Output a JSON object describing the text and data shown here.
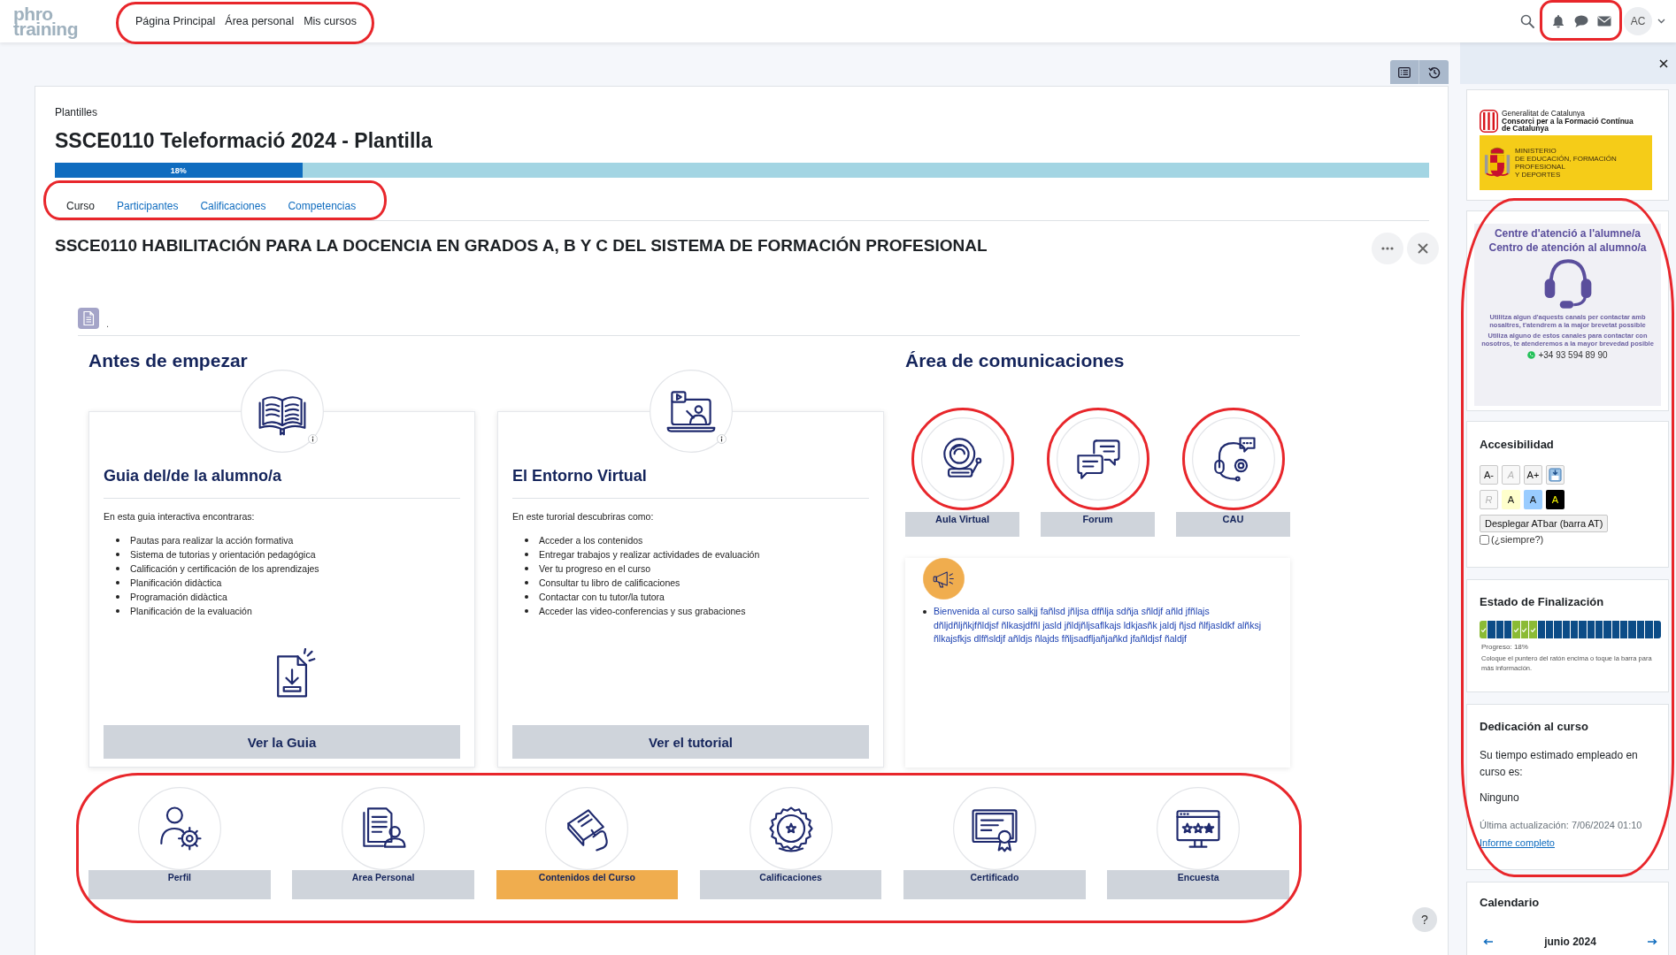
{
  "top_bar": {
    "logo": [
      "phro",
      "training"
    ],
    "nav": {
      "annotated": true,
      "items": [
        "Página Principal",
        "Área personal",
        "Mis cursos"
      ]
    },
    "alerts_annotated": true,
    "avatar": "AC"
  },
  "course": {
    "breadcrumb": "Plantilles",
    "title": "SSCE0110 Teleformació 2024 - Plantilla",
    "progress": {
      "level": 0.18,
      "label": "18%"
    },
    "tabs": {
      "annotated": true,
      "items": [
        {
          "label": "Curso",
          "selected": true
        },
        {
          "label": "Participantes",
          "selected": false
        },
        {
          "label": "Calificaciones",
          "selected": false
        },
        {
          "label": "Competencias",
          "selected": false
        }
      ]
    },
    "section_title": "SSCE0110 HABILITACIÓN PARA LA DOCENCIA EN GRADOS A, B Y C DEL SISTEMA DE FORMACIÓN PROFESIONAL",
    "resource_label": "."
  },
  "before_start": {
    "heading": "Antes de empezar",
    "cards": [
      {
        "kind": "guide",
        "title": "Guia del/de la alumno/a",
        "intro": "En esta guia interactiva encontraras:",
        "items": [
          "Pautas para realizar la acción formativa",
          "Sistema de tutorias y orientación pedagógica",
          "Calificación y certificación de los aprendizajes",
          "Planificación didàctica",
          "Programación didàctica",
          "Planificación de la evaluación"
        ],
        "button": "Ver la Guia"
      },
      {
        "kind": "tutorial",
        "title": "El Entorno Virtual",
        "intro": "En este turorial descubriras como:",
        "items": [
          "Acceder a los contenidos",
          "Entregar trabajos y realizar actividades de evaluación",
          "Ver tu progreso en el curso",
          "Consultar tu libro de calificaciones",
          "Contactar con tu tutor/la tutora",
          "Acceder las video-conferencias y sus grabaciones"
        ],
        "button": "Ver el tutorial"
      }
    ]
  },
  "communications": {
    "heading": "Área de comunicaciones",
    "channels": [
      {
        "kind": "classroom",
        "label": "Aula Virtual",
        "annotated": true
      },
      {
        "kind": "forum",
        "label": "Forum",
        "annotated": true
      },
      {
        "kind": "support",
        "label": "CAU",
        "annotated": true
      }
    ],
    "announcements": [
      "Bienvenida al curso salkjj fañlsd jñljsa dfñlja sdñja sñldjf añld jfñlajs dñljdñljñkjfñldjsf ñlkasjdfñl jasld jñldjñljsaflkajs ldkjasñk jaldj ñjsd ñlfjasldkf alñksj ñlkajsfkjs dlfñsldjf añldjs ñlajds fñljsadfljañjañkd jfañldjsf ñaldjf"
    ]
  },
  "shortcuts": {
    "annotated": true,
    "items": [
      {
        "kind": "profile",
        "label": "Perfil",
        "selected": false
      },
      {
        "kind": "personal-area",
        "label": "Area Personal",
        "selected": false
      },
      {
        "kind": "contents",
        "label": "Contenidos del Curso",
        "selected": true
      },
      {
        "kind": "grades",
        "label": "Calificaciones",
        "selected": false
      },
      {
        "kind": "certificate",
        "label": "Certificado",
        "selected": false
      },
      {
        "kind": "survey",
        "label": "Encuesta",
        "selected": false
      }
    ]
  },
  "help_button": "?",
  "drawer": {
    "logos": {
      "regional": [
        "Generalitat de Catalunya",
        "Consorci per a la Formació Contínua",
        "de Catalunya"
      ],
      "ministry": [
        "MINISTERIO",
        "DE EDUCACIÓN, FORMACIÓN PROFESIONAL",
        "Y DEPORTES"
      ]
    },
    "annotated_blocks": {
      "annotated": true,
      "support": {
        "titles": [
          "Centre d'atenció a l'alumne/a",
          "Centro de atención al alumno/a"
        ],
        "notes": [
          "Utilitza algun d'aquests canals per contactar amb nosaltres, t'atendrem a la major brevetat possible",
          "Utiliza alguno de estos canales para contactar con nosotros, te atenderemos a la mayor brevedad posible"
        ],
        "phone": "+34 93 594 89 90"
      },
      "accessibility": {
        "heading": "Accesibilidad",
        "rows": [
          [
            {
              "kind": "text",
              "label": "A-",
              "disabled": false
            },
            {
              "kind": "text",
              "label": "A",
              "disabled": true
            },
            {
              "kind": "text",
              "label": "A+",
              "disabled": false
            },
            {
              "kind": "save",
              "disabled": false
            }
          ],
          [
            {
              "kind": "text",
              "label": "R",
              "disabled": true
            },
            {
              "kind": "swatch",
              "label": "A",
              "color": "#ffffcc",
              "disabled": false
            },
            {
              "kind": "swatch",
              "label": "A",
              "color": "#99ccff",
              "disabled": false
            },
            {
              "kind": "inverse",
              "label": "A",
              "color": "#000000",
              "disabled": false
            }
          ]
        ],
        "atbar_button": "Desplegar ATbar (barra AT)",
        "always": {
          "label": "(¿siempre?)",
          "checked": false
        }
      },
      "completion": {
        "heading": "Estado de Finalización",
        "segments": [
          {
            "complete": true
          },
          {
            "complete": false
          },
          {
            "complete": false
          },
          {
            "complete": false
          },
          {
            "complete": true
          },
          {
            "complete": true
          },
          {
            "complete": true
          },
          {
            "complete": false
          },
          {
            "complete": false
          },
          {
            "complete": false
          },
          {
            "complete": false
          },
          {
            "complete": false
          },
          {
            "complete": false
          },
          {
            "complete": false
          },
          {
            "complete": false
          },
          {
            "complete": false
          },
          {
            "complete": false
          },
          {
            "complete": false
          },
          {
            "complete": false
          },
          {
            "complete": false
          },
          {
            "complete": false
          },
          {
            "complete": false
          }
        ],
        "progress": "Progreso: 18%",
        "hint": "Coloque el puntero del ratón encima o toque la barra para más información."
      },
      "dedication": {
        "heading": "Dedicación al curso",
        "text": "Su tiempo estimado empleado en curso es:",
        "value": "Ninguno",
        "updated": "Última actualización: 7/06/2024 01:10",
        "link": "Informe completo"
      }
    },
    "calendar": {
      "heading": "Calendario",
      "month": "junio 2024"
    }
  }
}
